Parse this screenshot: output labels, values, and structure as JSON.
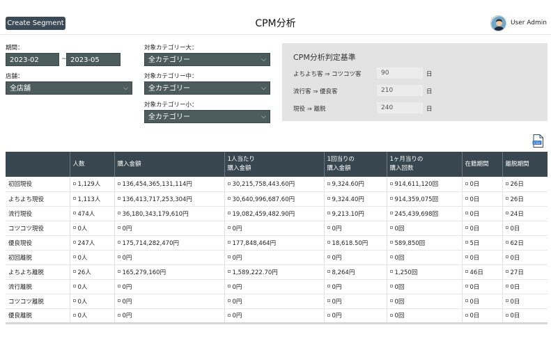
{
  "header": {
    "create_button": "Create Segment",
    "title": "CPM分析",
    "user_name": "User Admin"
  },
  "filters": {
    "period_label": "期間：",
    "period_from": "2023-02",
    "period_sep": "~",
    "period_to": "2023-05",
    "store_label": "店舗：",
    "store_value": "全店舗",
    "category_large_label": "対象カテゴリー大：",
    "category_large_value": "全カテゴリー",
    "category_mid_label": "対象カテゴリー中：",
    "category_mid_value": "全カテゴリー",
    "category_small_label": "対象カテゴリー小：",
    "category_small_value": "全カテゴリー"
  },
  "criteria": {
    "title": "CPM分析判定基準",
    "rows": [
      {
        "label": "よちよち客 ⇒ コツコツ客",
        "value": "90",
        "unit": "日"
      },
      {
        "label": "流行客 ⇒ 優良客",
        "value": "210",
        "unit": "日"
      },
      {
        "label": "現役 ⇒ 離脱",
        "value": "240",
        "unit": "日"
      }
    ]
  },
  "icons": {
    "csv": "csv-download-icon",
    "avatar": "user-avatar"
  },
  "table": {
    "headers": [
      "",
      "人数",
      "購入金額",
      "1人当たり\n購入金額",
      "1回当りの\n購入金額",
      "1ヶ月当りの\n購入回数",
      "在籍期間",
      "離脱期間"
    ],
    "rows": [
      [
        "初回現役",
        "1,129人",
        "136,454,365,131,114円",
        "30,215,758,443.60円",
        "9,324.60円",
        "914,611,120回",
        "0日",
        "26日"
      ],
      [
        "よちよち現役",
        "1,113人",
        "136,413,717,253,304円",
        "30,640,996,687.60円",
        "9,324.40円",
        "914,359,075回",
        "0日",
        "26日"
      ],
      [
        "流行現役",
        "474人",
        "36,180,343,179,610円",
        "19,082,459,482.90円",
        "9,213.10円",
        "245,439,698回",
        "0日",
        "24日"
      ],
      [
        "コツコツ現役",
        "0人",
        "0円",
        "0円",
        "0円",
        "0回",
        "0日",
        "0日"
      ],
      [
        "優良現役",
        "247人",
        "175,714,282,470円",
        "177,848,464円",
        "18,618.50円",
        "589,850回",
        "5日",
        "62日"
      ],
      [
        "初回離脱",
        "0人",
        "0円",
        "0円",
        "0円",
        "0回",
        "0日",
        "0日"
      ],
      [
        "よちよち離脱",
        "26人",
        "165,279,160円",
        "1,589,222.70円",
        "8,264円",
        "1,250回",
        "46日",
        "27日"
      ],
      [
        "流行離脱",
        "0人",
        "0円",
        "0円",
        "0円",
        "0回",
        "0日",
        "0日"
      ],
      [
        "コツコツ離脱",
        "0人",
        "0円",
        "0円",
        "0円",
        "0回",
        "0日",
        "0日"
      ],
      [
        "優良離脱",
        "0人",
        "0円",
        "0円",
        "0円",
        "0回",
        "0日",
        "0日"
      ]
    ]
  }
}
